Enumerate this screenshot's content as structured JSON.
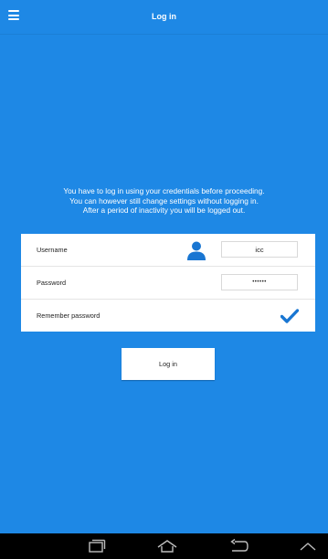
{
  "header": {
    "title": "Log in",
    "menu_icon": "hamburger-menu-icon"
  },
  "notice": {
    "lines": [
      "You have to log in using your credentials before proceeding.",
      "You can however still change settings without logging in.",
      "After a period of inactivity you will be logged out."
    ]
  },
  "form": {
    "username": {
      "label": "Username",
      "value": "icc",
      "icon": "user-icon"
    },
    "password": {
      "label": "Password",
      "value": "••••••"
    },
    "remember": {
      "label": "Remember password",
      "checked": true,
      "icon": "checkmark-icon"
    }
  },
  "login_button": {
    "label": "Log in"
  },
  "nav_bar": {
    "icons": [
      "recent-apps-icon",
      "home-icon",
      "back-icon",
      "collapse-icon"
    ]
  },
  "colors": {
    "background": "#1e88e5",
    "accent": "#1976d2",
    "card": "#ffffff",
    "nav": "#000000"
  }
}
